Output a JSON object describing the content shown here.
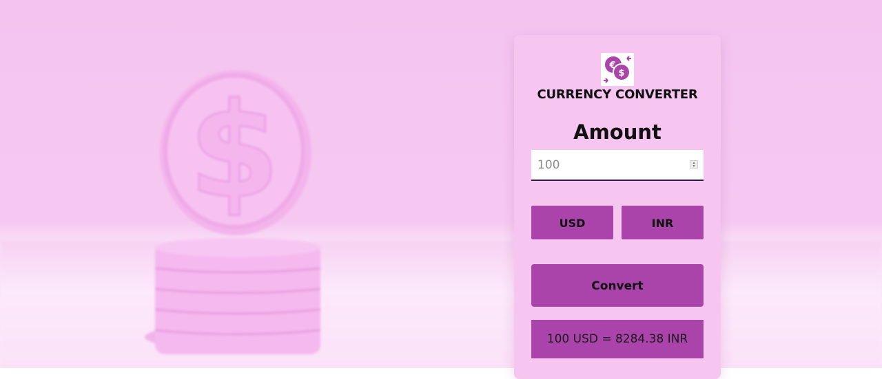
{
  "app": {
    "title": "CURRENCY CONVERTER",
    "logo_icon": "currency-exchange-icon"
  },
  "form": {
    "amount_label": "Amount",
    "amount_value": "100",
    "from_currency": "USD",
    "to_currency": "INR",
    "convert_label": "Convert",
    "result_text": "100 USD = 8284.38 INR"
  },
  "colors": {
    "accent": "#aa44aa",
    "card_background": "#f6c6f0",
    "page_background": "#f4c4ef"
  }
}
